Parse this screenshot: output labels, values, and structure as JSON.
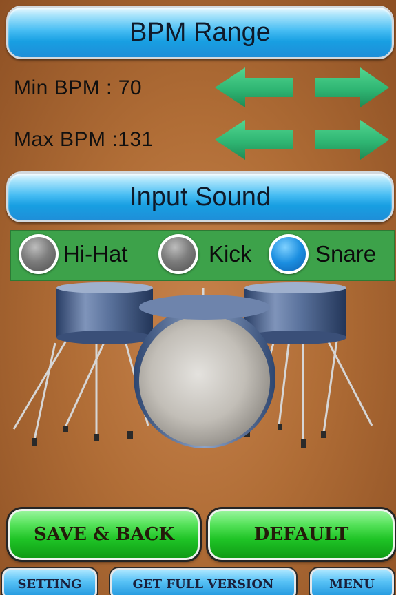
{
  "bpm_range": {
    "header": "BPM Range",
    "min_label": "Min  BPM :  70",
    "max_label": "Max BPM :131",
    "min_value": 70,
    "max_value": 131
  },
  "input_sound": {
    "header": "Input Sound",
    "options": [
      {
        "label": "Hi-Hat",
        "selected": false
      },
      {
        "label": "Kick",
        "selected": false
      },
      {
        "label": "Snare",
        "selected": true
      }
    ]
  },
  "actions": {
    "save_back": "SAVE & BACK",
    "default": "DEFAULT"
  },
  "bottom_nav": {
    "setting": "SETTING",
    "get_full_version": "GET FULL VERSION",
    "menu": "MENU"
  },
  "icons": {
    "decrease": "left-arrow-icon",
    "increase": "right-arrow-icon",
    "illustration": "drum-kit-icon"
  },
  "colors": {
    "background": "#b06d36",
    "header_blue": "#189fe2",
    "arrow_green": "#2fb673",
    "panel_green": "#3da24a",
    "button_green": "#1fc426",
    "radio_selected": "#1b8ee0"
  }
}
